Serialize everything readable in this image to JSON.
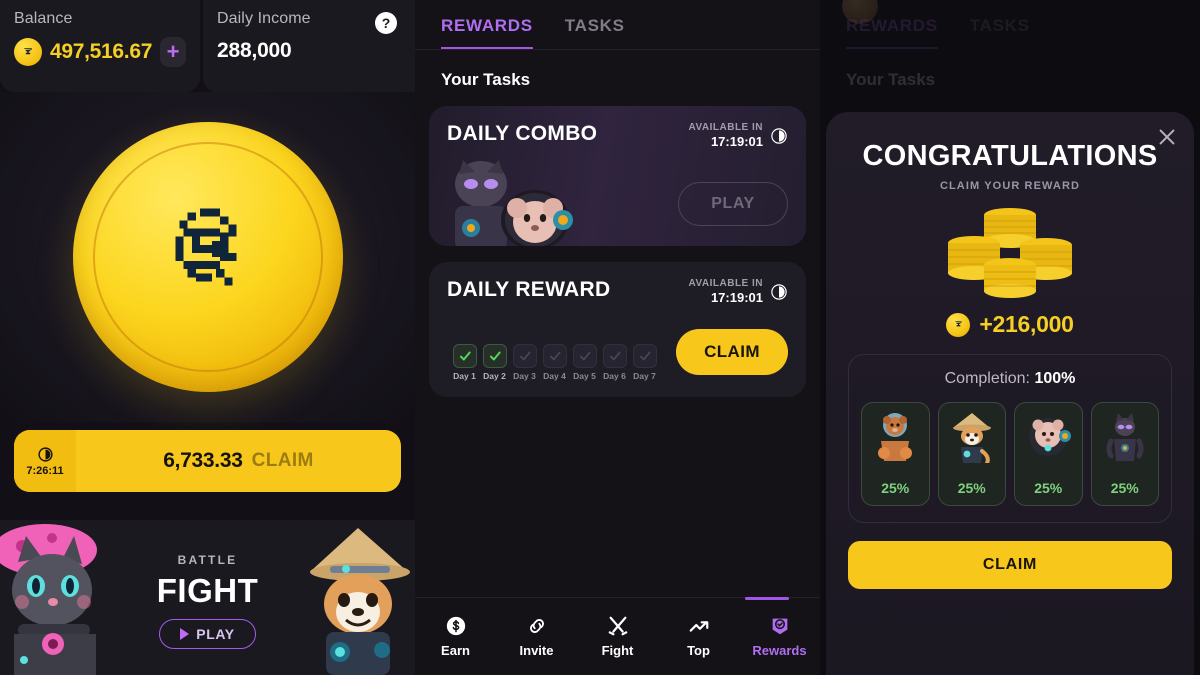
{
  "panel_left": {
    "balance": {
      "label": "Balance",
      "value": "497,516.67",
      "add_label": "+",
      "coin_icon": "coin-icon"
    },
    "daily_income": {
      "label": "Daily Income",
      "value": "288,000",
      "help_label": "?"
    },
    "coin": {
      "icon": "pixel-spiral-coin-icon"
    },
    "claim_bar": {
      "timer": "7:26:11",
      "amount": "6,733.33",
      "action": "CLAIM",
      "clock_icon": "clock-icon"
    },
    "battle": {
      "kicker": "BATTLE",
      "title": "FIGHT",
      "play_label": "PLAY",
      "left_character": "cat-character",
      "right_character": "shiba-character"
    }
  },
  "panel_mid": {
    "tabs": [
      {
        "label": "REWARDS",
        "active": true
      },
      {
        "label": "TASKS",
        "active": false
      }
    ],
    "section_title": "Your Tasks",
    "cards": [
      {
        "title": "DAILY COMBO",
        "available_label": "AVAILABLE IN",
        "available_time": "17:19:01",
        "clock_icon": "clock-icon",
        "button": "PLAY",
        "button_enabled": false
      },
      {
        "title": "DAILY REWARD",
        "available_label": "AVAILABLE IN",
        "available_time": "17:19:01",
        "clock_icon": "clock-icon",
        "button": "CLAIM",
        "button_enabled": true,
        "days": [
          {
            "label": "Day 1",
            "done": true
          },
          {
            "label": "Day 2",
            "done": true
          },
          {
            "label": "Day 3",
            "done": false
          },
          {
            "label": "Day 4",
            "done": false
          },
          {
            "label": "Day 5",
            "done": false
          },
          {
            "label": "Day 6",
            "done": false
          },
          {
            "label": "Day 7",
            "done": false
          }
        ]
      }
    ],
    "bottom_nav": [
      {
        "label": "Earn",
        "icon": "dollar-coin-icon",
        "active": false
      },
      {
        "label": "Invite",
        "icon": "link-icon",
        "active": false
      },
      {
        "label": "Fight",
        "icon": "crossed-swords-icon",
        "active": false
      },
      {
        "label": "Top",
        "icon": "trending-up-icon",
        "active": false
      },
      {
        "label": "Rewards",
        "icon": "reward-badge-icon",
        "active": true
      }
    ]
  },
  "panel_right": {
    "background_tabs": [
      {
        "label": "REWARDS",
        "active": true
      },
      {
        "label": "TASKS",
        "active": false
      }
    ],
    "background_section_title": "Your Tasks",
    "modal": {
      "close_icon": "close-icon",
      "title": "CONGRATULATIONS",
      "subtitle": "CLAIM YOUR REWARD",
      "coins_icon": "coin-stack-icon",
      "reward_coin_icon": "coin-icon",
      "reward_value": "+216,000",
      "completion_label": "Completion:",
      "completion_value": "100%",
      "characters": [
        {
          "name": "bear-character",
          "percent": "25%"
        },
        {
          "name": "shiba-character",
          "percent": "25%"
        },
        {
          "name": "hamster-character",
          "percent": "25%"
        },
        {
          "name": "panther-character",
          "percent": "25%"
        }
      ],
      "claim_label": "CLAIM"
    }
  },
  "colors": {
    "accent_yellow": "#f7c81b",
    "accent_purple": "#b06ef0",
    "success_green": "#7fd17f",
    "background": "#141217"
  }
}
